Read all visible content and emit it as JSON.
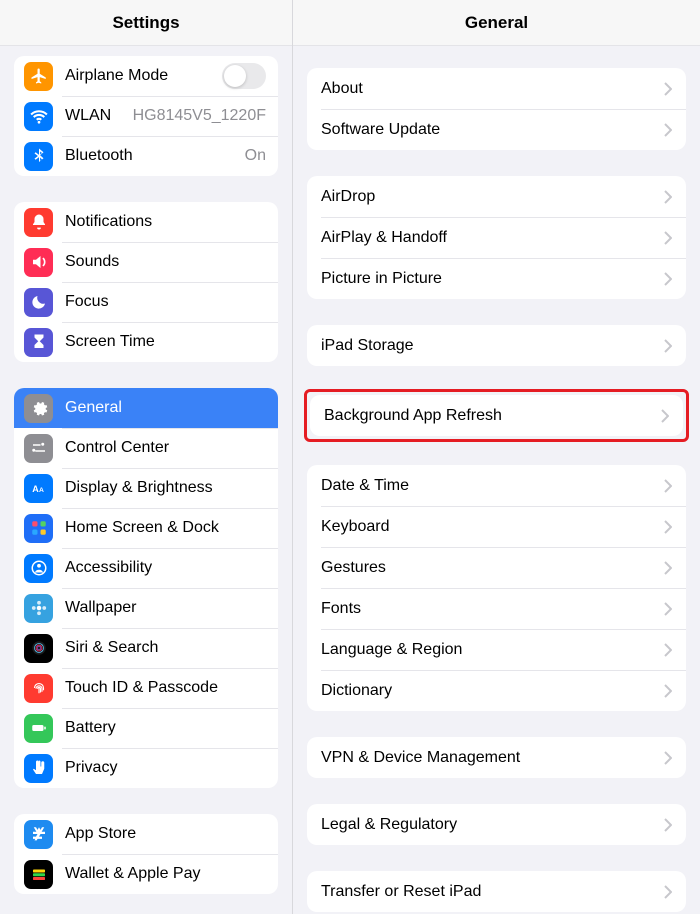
{
  "sidebar": {
    "title": "Settings",
    "groups": [
      {
        "items": [
          {
            "id": "airplane",
            "label": "Airplane Mode",
            "toggle": false,
            "iconBg": "bg-orange",
            "icon": "airplane"
          },
          {
            "id": "wlan",
            "label": "WLAN",
            "value": "HG8145V5_1220F",
            "iconBg": "bg-blue",
            "icon": "wifi"
          },
          {
            "id": "bluetooth",
            "label": "Bluetooth",
            "value": "On",
            "iconBg": "bg-blue",
            "icon": "bluetooth"
          }
        ]
      },
      {
        "items": [
          {
            "id": "notifications",
            "label": "Notifications",
            "iconBg": "bg-red",
            "icon": "bell"
          },
          {
            "id": "sounds",
            "label": "Sounds",
            "iconBg": "bg-pink",
            "icon": "speaker"
          },
          {
            "id": "focus",
            "label": "Focus",
            "iconBg": "bg-purple",
            "icon": "moon"
          },
          {
            "id": "screentime",
            "label": "Screen Time",
            "iconBg": "bg-purple",
            "icon": "hourglass"
          }
        ]
      },
      {
        "items": [
          {
            "id": "general",
            "label": "General",
            "selected": true,
            "iconBg": "bg-gray",
            "icon": "gear"
          },
          {
            "id": "controlcenter",
            "label": "Control Center",
            "iconBg": "bg-gray",
            "icon": "switches"
          },
          {
            "id": "display",
            "label": "Display & Brightness",
            "iconBg": "bg-blue",
            "icon": "aa"
          },
          {
            "id": "homescreen",
            "label": "Home Screen & Dock",
            "iconBg": "bg-darkblue",
            "icon": "grid"
          },
          {
            "id": "accessibility",
            "label": "Accessibility",
            "iconBg": "bg-blue",
            "icon": "person"
          },
          {
            "id": "wallpaper",
            "label": "Wallpaper",
            "iconBg": "bg-atom",
            "icon": "flower"
          },
          {
            "id": "siri",
            "label": "Siri & Search",
            "iconBg": "bg-black",
            "icon": "siri"
          },
          {
            "id": "touchid",
            "label": "Touch ID & Passcode",
            "iconBg": "bg-redpink",
            "icon": "fingerprint"
          },
          {
            "id": "battery",
            "label": "Battery",
            "iconBg": "bg-green",
            "icon": "battery"
          },
          {
            "id": "privacy",
            "label": "Privacy",
            "iconBg": "bg-blue",
            "icon": "hand"
          }
        ]
      },
      {
        "items": [
          {
            "id": "appstore",
            "label": "App Store",
            "iconBg": "bg-appstore",
            "icon": "appstore"
          },
          {
            "id": "wallet",
            "label": "Wallet & Apple Pay",
            "iconBg": "bg-wallet",
            "icon": "wallet"
          }
        ]
      }
    ]
  },
  "detail": {
    "title": "General",
    "groups": [
      {
        "items": [
          {
            "id": "about",
            "label": "About"
          },
          {
            "id": "software-update",
            "label": "Software Update"
          }
        ]
      },
      {
        "items": [
          {
            "id": "airdrop",
            "label": "AirDrop"
          },
          {
            "id": "airplay",
            "label": "AirPlay & Handoff"
          },
          {
            "id": "pip",
            "label": "Picture in Picture"
          }
        ]
      },
      {
        "items": [
          {
            "id": "storage",
            "label": "iPad Storage"
          }
        ]
      },
      {
        "highlighted": true,
        "items": [
          {
            "id": "bg-refresh",
            "label": "Background App Refresh"
          }
        ]
      },
      {
        "items": [
          {
            "id": "date-time",
            "label": "Date & Time"
          },
          {
            "id": "keyboard",
            "label": "Keyboard"
          },
          {
            "id": "gestures",
            "label": "Gestures"
          },
          {
            "id": "fonts",
            "label": "Fonts"
          },
          {
            "id": "language",
            "label": "Language & Region"
          },
          {
            "id": "dictionary",
            "label": "Dictionary"
          }
        ]
      },
      {
        "items": [
          {
            "id": "vpn",
            "label": "VPN & Device Management"
          }
        ]
      },
      {
        "items": [
          {
            "id": "legal",
            "label": "Legal & Regulatory"
          }
        ]
      },
      {
        "items": [
          {
            "id": "transfer",
            "label": "Transfer or Reset iPad"
          }
        ]
      }
    ]
  },
  "colors": {
    "accent": "#3a82f7",
    "highlight": "#e51c23"
  }
}
